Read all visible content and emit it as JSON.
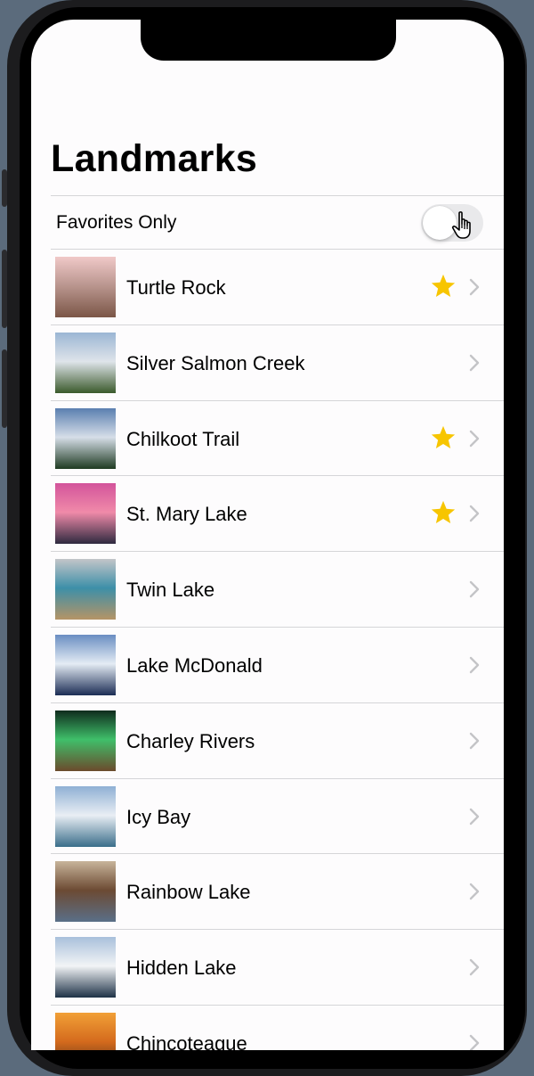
{
  "app": {
    "title": "Landmarks"
  },
  "filter": {
    "label": "Favorites Only",
    "favorites_only": false
  },
  "landmarks": [
    {
      "name": "Turtle Rock",
      "favorite": true,
      "thumb_icon": "turtle-rock-photo",
      "colors": [
        "#f0c9c8",
        "#b9958e",
        "#7b5647"
      ]
    },
    {
      "name": "Silver Salmon Creek",
      "favorite": false,
      "thumb_icon": "silver-salmon-creek-photo",
      "colors": [
        "#9bb6d4",
        "#dfe4ea",
        "#3b5a2c"
      ]
    },
    {
      "name": "Chilkoot Trail",
      "favorite": true,
      "thumb_icon": "chilkoot-trail-photo",
      "colors": [
        "#5a7fb0",
        "#d6dee8",
        "#1f3b22"
      ]
    },
    {
      "name": "St. Mary Lake",
      "favorite": true,
      "thumb_icon": "st-mary-lake-photo",
      "colors": [
        "#d3549b",
        "#f08aa9",
        "#2f2a3f"
      ]
    },
    {
      "name": "Twin Lake",
      "favorite": false,
      "thumb_icon": "twin-lake-photo",
      "colors": [
        "#c3c5c9",
        "#3d8fa8",
        "#b59466"
      ]
    },
    {
      "name": "Lake McDonald",
      "favorite": false,
      "thumb_icon": "lake-mcdonald-photo",
      "colors": [
        "#6a8ec2",
        "#e4ecf4",
        "#1c2d55"
      ]
    },
    {
      "name": "Charley Rivers",
      "favorite": false,
      "thumb_icon": "charley-rivers-photo",
      "colors": [
        "#0f2b1d",
        "#3fbf6a",
        "#6b4a2c"
      ]
    },
    {
      "name": "Icy Bay",
      "favorite": false,
      "thumb_icon": "icy-bay-photo",
      "colors": [
        "#8fb0d4",
        "#e9eef4",
        "#3b6e8a"
      ]
    },
    {
      "name": "Rainbow Lake",
      "favorite": false,
      "thumb_icon": "rainbow-lake-photo",
      "colors": [
        "#c7b49a",
        "#6c4a33",
        "#5a6f88"
      ]
    },
    {
      "name": "Hidden Lake",
      "favorite": false,
      "thumb_icon": "hidden-lake-photo",
      "colors": [
        "#a9c0db",
        "#f2f4f6",
        "#1e3247"
      ]
    },
    {
      "name": "Chincoteague",
      "favorite": false,
      "thumb_icon": "chincoteague-photo",
      "colors": [
        "#f1a037",
        "#d46a1d",
        "#4a2c16"
      ]
    }
  ],
  "colors": {
    "star": "#f7c500",
    "chevron": "#c4c4c7",
    "toggle_off": "#e9e9eb",
    "separator": "#d5d5d8",
    "background": "#fdfcfd"
  },
  "icons": {
    "row_favorite": "star-icon",
    "row_disclosure": "chevron-right-icon",
    "pointer": "hand-pointer-icon"
  }
}
